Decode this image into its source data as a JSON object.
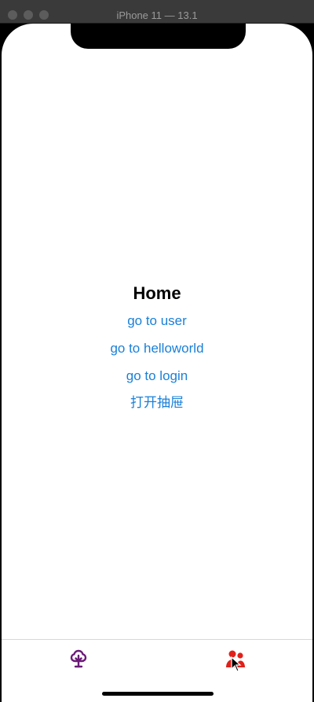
{
  "window": {
    "title": "iPhone 11 — 13.1"
  },
  "main": {
    "title": "Home",
    "links": [
      {
        "label": "go to user"
      },
      {
        "label": "go to helloworld"
      },
      {
        "label": "go to login"
      },
      {
        "label": "打开抽屉"
      }
    ]
  },
  "tabbar": {
    "items": [
      {
        "icon": "tree-icon",
        "color": "#6b1a78",
        "active": false
      },
      {
        "icon": "users-icon",
        "color": "#e0211a",
        "active": true
      }
    ]
  },
  "colors": {
    "link": "#1a80d8",
    "title": "#000000"
  }
}
